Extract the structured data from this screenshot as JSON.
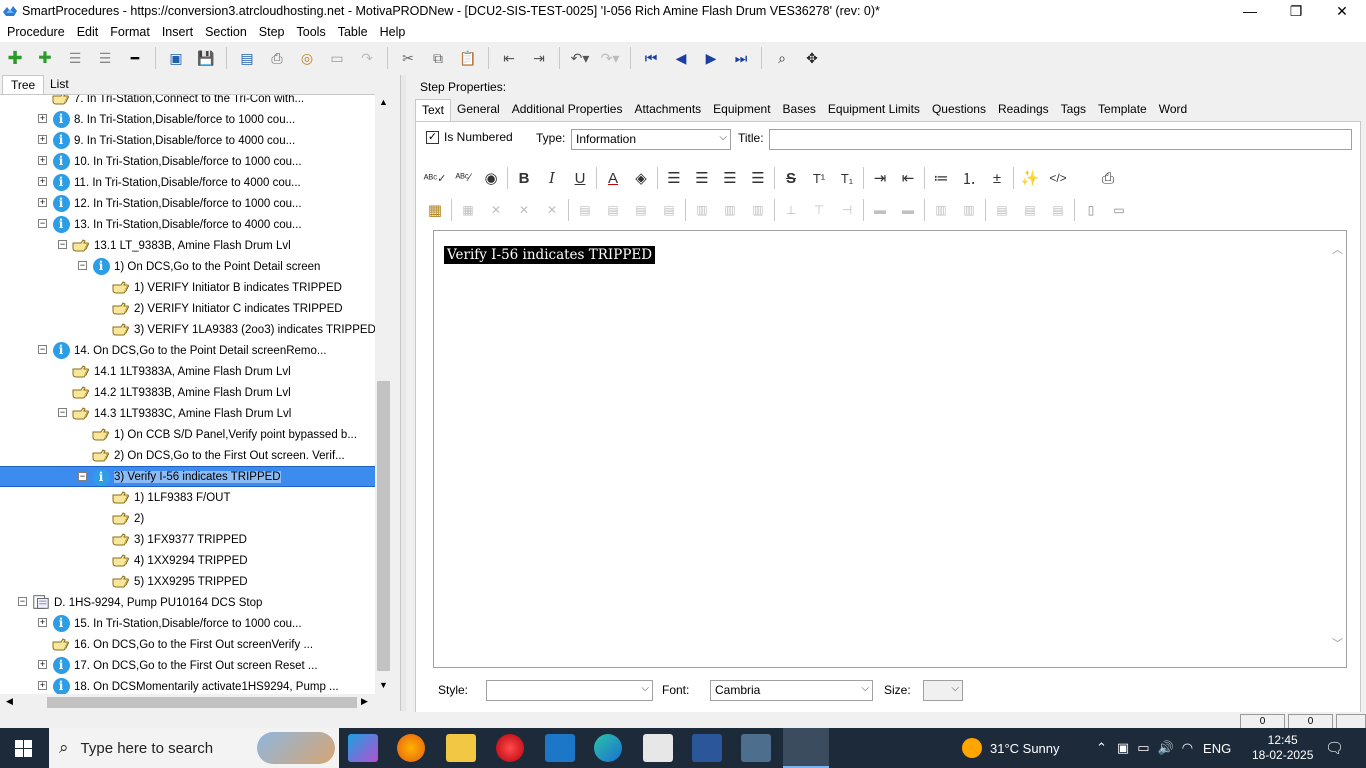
{
  "window": {
    "title": "SmartProcedures - https://conversion3.atrcloudhosting.net - MotivaPRODNew - [DCU2-SIS-TEST-0025] 'I-056 Rich Amine Flash Drum VES36278' (rev: 0)*",
    "minimize": "—",
    "restore": "❐",
    "close": "✕"
  },
  "menu": [
    "Procedure",
    "Edit",
    "Format",
    "Insert",
    "Section",
    "Step",
    "Tools",
    "Table",
    "Help"
  ],
  "left_tabs": [
    "Tree",
    "List"
  ],
  "tree": [
    {
      "text": "7. In Tri-Station,Connect to the Tri-Con with...",
      "icon": "hand",
      "indent": 0,
      "expander": ""
    },
    {
      "text": "8. In Tri-Station,Disable/force to 1000 cou...",
      "icon": "info",
      "indent": 0,
      "expander": "+"
    },
    {
      "text": "9. In Tri-Station,Disable/force to 4000 cou...",
      "icon": "info",
      "indent": 0,
      "expander": "+"
    },
    {
      "text": "10. In Tri-Station,Disable/force to 1000 cou...",
      "icon": "info",
      "indent": 0,
      "expander": "+"
    },
    {
      "text": "11. In Tri-Station,Disable/force to 4000 cou...",
      "icon": "info",
      "indent": 0,
      "expander": "+"
    },
    {
      "text": "12. In Tri-Station,Disable/force to 1000 cou...",
      "icon": "info",
      "indent": 0,
      "expander": "+"
    },
    {
      "text": "13. In Tri-Station,Disable/force to 4000 cou...",
      "icon": "info",
      "indent": 0,
      "expander": "−"
    },
    {
      "text": "13.1 LT_9383B, Amine Flash Drum Lvl",
      "icon": "hand",
      "indent": 1,
      "expander": "−"
    },
    {
      "text": "1) On DCS,Go to the Point Detail screen",
      "icon": "info",
      "indent": 2,
      "expander": "−"
    },
    {
      "text": "1) VERIFY Initiator B indicates TRIPPED",
      "icon": "hand",
      "indent": 3,
      "expander": ""
    },
    {
      "text": "2) VERIFY Initiator C indicates TRIPPED",
      "icon": "hand",
      "indent": 3,
      "expander": ""
    },
    {
      "text": "3) VERIFY 1LA9383 (2oo3) indicates TRIPPED",
      "icon": "hand",
      "indent": 3,
      "expander": ""
    },
    {
      "text": "14. On DCS,Go to the Point Detail screenRemo...",
      "icon": "info",
      "indent": 0,
      "expander": "−"
    },
    {
      "text": "14.1 1LT9383A, Amine Flash Drum Lvl",
      "icon": "hand",
      "indent": 1,
      "expander": ""
    },
    {
      "text": "14.2 1LT9383B, Amine Flash Drum Lvl",
      "icon": "hand",
      "indent": 1,
      "expander": ""
    },
    {
      "text": "14.3 1LT9383C, Amine Flash Drum Lvl",
      "icon": "hand",
      "indent": 1,
      "expander": "−"
    },
    {
      "text": "1) On CCB S/D Panel,Verify point bypassed b...",
      "icon": "hand",
      "indent": 2,
      "expander": ""
    },
    {
      "text": "2) On DCS,Go to the First Out screen. Verif...",
      "icon": "hand",
      "indent": 2,
      "expander": ""
    },
    {
      "text": "3) Verify I-56 indicates TRIPPED",
      "icon": "info",
      "indent": 2,
      "expander": "−",
      "selected": true
    },
    {
      "text": "1) 1LF9383 F/OUT",
      "icon": "hand",
      "indent": 3,
      "expander": ""
    },
    {
      "text": "2)",
      "icon": "hand",
      "indent": 3,
      "expander": ""
    },
    {
      "text": "3) 1FX9377 TRIPPED",
      "icon": "hand",
      "indent": 3,
      "expander": ""
    },
    {
      "text": "4) 1XX9294 TRIPPED",
      "icon": "hand",
      "indent": 3,
      "expander": ""
    },
    {
      "text": "5) 1XX9295 TRIPPED",
      "icon": "hand",
      "indent": 3,
      "expander": ""
    },
    {
      "text": "D. 1HS-9294, Pump PU10164 DCS Stop",
      "icon": "section",
      "indent": -1,
      "expander": "−"
    },
    {
      "text": "15. In Tri-Station,Disable/force to 1000 cou...",
      "icon": "info",
      "indent": 0,
      "expander": "+"
    },
    {
      "text": "16. On DCS,Go to the First Out screenVerify ...",
      "icon": "hand",
      "indent": 0,
      "expander": ""
    },
    {
      "text": "17. On DCS,Go to the First Out screen Reset ...",
      "icon": "info",
      "indent": 0,
      "expander": "+"
    },
    {
      "text": "18. On DCSMomentarily activate1HS9294, Pump ...",
      "icon": "info",
      "indent": 0,
      "expander": "+"
    }
  ],
  "step_properties": {
    "heading": "Step Properties:",
    "tabs": [
      "Text",
      "General",
      "Additional Properties",
      "Attachments",
      "Equipment",
      "Bases",
      "Equipment Limits",
      "Questions",
      "Readings",
      "Tags",
      "Template",
      "Word"
    ],
    "is_numbered_label": "Is Numbered",
    "type_label": "Type:",
    "type_value": "Information",
    "title_label": "Title:",
    "title_value": "",
    "content": "Verify I-56 indicates TRIPPED",
    "style_label": "Style:",
    "style_value": "",
    "font_label": "Font:",
    "font_value": "Cambria",
    "size_label": "Size:",
    "size_value": ""
  },
  "format_toolbar": {
    "bold": "B",
    "italic": "I",
    "underline": "U",
    "strike": "S",
    "superscript": "T¹",
    "subscript": "T₁",
    "source": "</>"
  },
  "status": {
    "left": "0",
    "right": "0"
  },
  "taskbar": {
    "search_placeholder": "Type here to search",
    "weather": "31°C  Sunny",
    "language": "ENG",
    "time": "12:45",
    "date": "18-02-2025"
  },
  "colors": {
    "selection": "#3c8cf0",
    "info_icon": "#2d9ee6",
    "taskbar": "#1c2a3a"
  }
}
